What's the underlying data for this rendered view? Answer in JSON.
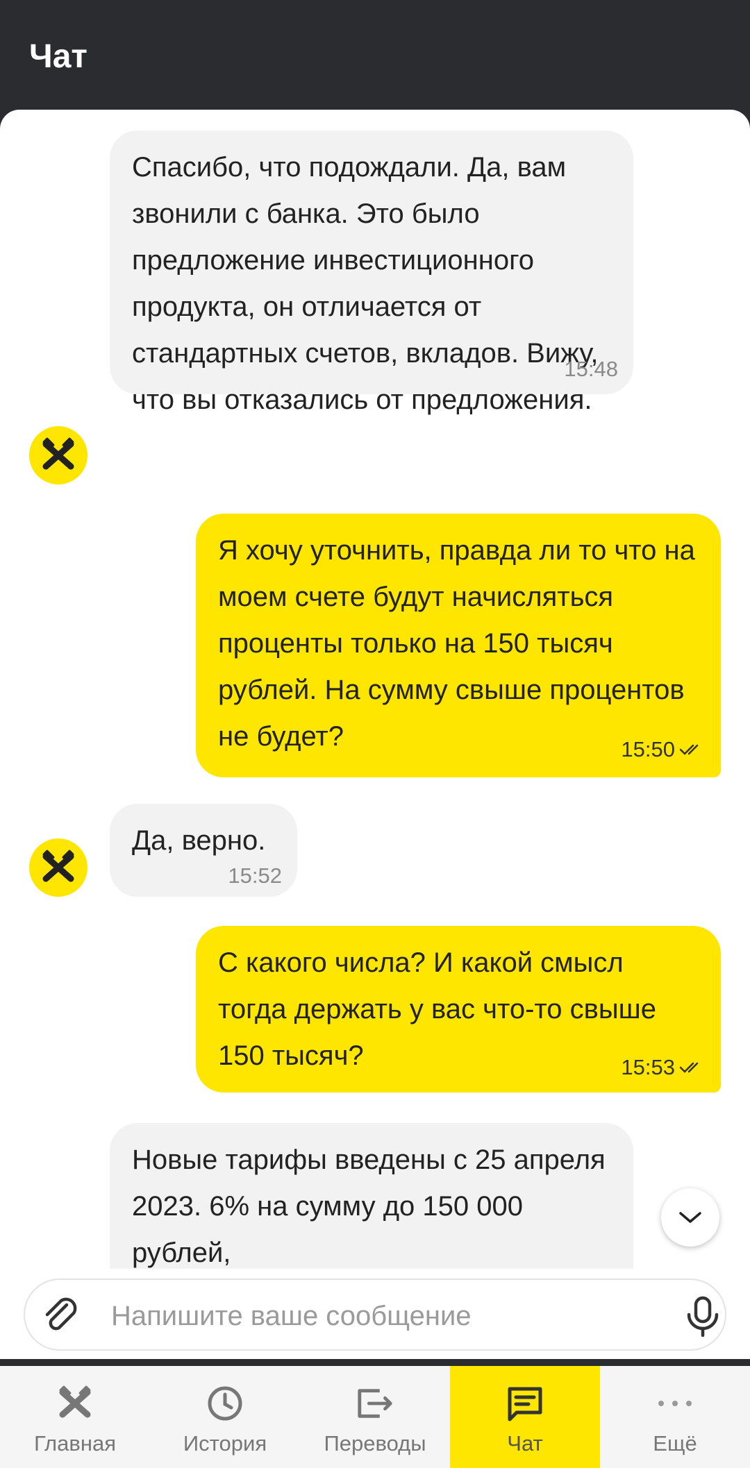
{
  "header": {
    "title": "Чат"
  },
  "messages": [
    {
      "text": "Спасибо, что подождали. Да, вам звонили с банка. Это было предложение инвестиционного продукта, он отличается от стандартных счетов, вкладов. Вижу, что вы отказались от предложения.",
      "time": "15:48"
    },
    {
      "text": "Я хочу уточнить, правда ли то что на моем счете будут начисляться проценты только на 150 тысяч рублей. На сумму свыше процентов не будет?",
      "time": "15:50"
    },
    {
      "text": "Да, верно.",
      "time": "15:52"
    },
    {
      "text": "С какого числа? И какой смысл тогда держать у вас что-то свыше 150 тысяч?",
      "time": "15:53"
    },
    {
      "text": "Новые тарифы введены с 25 апреля 2023. 6% на сумму до 150 000 рублей,",
      "time": ""
    }
  ],
  "composer": {
    "placeholder": "Напишите ваше сообщение",
    "value": ""
  },
  "tabs": [
    {
      "label": "Главная",
      "icon": "home-logo-icon"
    },
    {
      "label": "История",
      "icon": "clock-icon"
    },
    {
      "label": "Переводы",
      "icon": "transfer-icon"
    },
    {
      "label": "Чат",
      "icon": "chat-icon",
      "active": true
    },
    {
      "label": "Ещё",
      "icon": "more-dots-icon"
    }
  ],
  "colors": {
    "accent": "#fee600",
    "header": "#2b2c30",
    "incoming": "#f2f2f2",
    "tabbar": "#f5f5f5"
  }
}
